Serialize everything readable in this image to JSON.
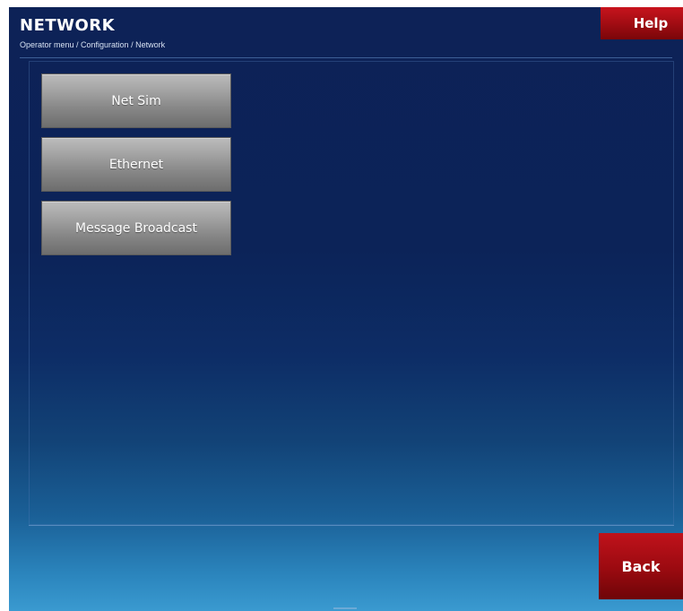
{
  "header": {
    "title": "NETWORK",
    "breadcrumb": "Operator menu / Configuration / Network",
    "help_label": "Help"
  },
  "menu": {
    "items": [
      {
        "label": "Net Sim"
      },
      {
        "label": "Ethernet"
      },
      {
        "label": "Message Broadcast"
      }
    ]
  },
  "footer": {
    "back_label": "Back"
  },
  "colors": {
    "background": "#0c2358",
    "accent_red": "#b0101a",
    "button_gray": "#9a9a9a"
  }
}
